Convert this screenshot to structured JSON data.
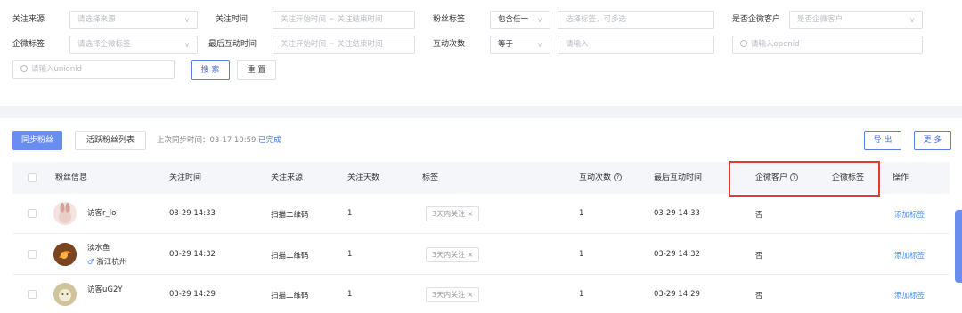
{
  "filters": {
    "row1": {
      "source_label": "关注来源",
      "source_placeholder": "请选择来源",
      "follow_time_label": "关注时间",
      "follow_time_placeholder": "关注开始时间 ~ 关注结束时间",
      "fan_tag_label": "粉丝标签",
      "fan_tag_mode": "包含任一",
      "fan_tag_placeholder": "选择标签，可多选",
      "wecom_customer_label": "是否企微客户",
      "wecom_customer_placeholder": "是否企微客户"
    },
    "row2": {
      "wecom_tag_label": "企微标签",
      "wecom_tag_placeholder": "请选择企微标签",
      "last_interact_label": "最后互动时间",
      "last_interact_placeholder": "关注开始时间 ~ 关注结束时间",
      "interact_count_label": "互动次数",
      "interact_count_op": "等于",
      "interact_count_placeholder": "请输入",
      "openid_placeholder": "请输入openid"
    },
    "row3": {
      "unionid_placeholder": "请输入unionid",
      "search_label": "搜 索",
      "reset_label": "重 置"
    }
  },
  "toolbar": {
    "sync_label": "同步粉丝",
    "active_list_label": "活跃粉丝列表",
    "last_sync_text": "上次同步时间：03-17 10:59",
    "sync_status": "已完成",
    "export_label": "导 出",
    "more_label": "更 多"
  },
  "table": {
    "headers": {
      "fan_info": "粉丝信息",
      "follow_time": "关注时间",
      "follow_source": "关注来源",
      "follow_days": "关注天数",
      "tags": "标签",
      "interact_count": "互动次数",
      "last_interact": "最后互动时间",
      "wecom_customer": "企微客户",
      "wecom_tag": "企微标签",
      "actions": "操作"
    },
    "rows": [
      {
        "name": "访客r_lo",
        "location": "",
        "follow_time": "03-29 14:33",
        "source": "扫描二维码",
        "days": "1",
        "tag": "3天内关注 ×",
        "interact": "1",
        "last_interact": "03-29 14:33",
        "wecom": "否",
        "action": "添加标签"
      },
      {
        "name": "淡水鱼",
        "location": "浙江杭州",
        "gender": "♂",
        "follow_time": "03-29 14:32",
        "source": "扫描二维码",
        "days": "1",
        "tag": "3天内关注 ×",
        "interact": "1",
        "last_interact": "03-29 14:32",
        "wecom": "否",
        "action": "添加标签"
      },
      {
        "name": "访客uG2Y",
        "location": "",
        "follow_time": "03-29 14:29",
        "source": "扫描二维码",
        "days": "1",
        "tag": "3天内关注 ×",
        "interact": "1",
        "last_interact": "03-29 14:29",
        "wecom": "否",
        "action": "添加标签"
      }
    ]
  },
  "colors": {
    "accent": "#4a6fe3",
    "highlight": "#e53935",
    "link": "#4a8df5"
  }
}
